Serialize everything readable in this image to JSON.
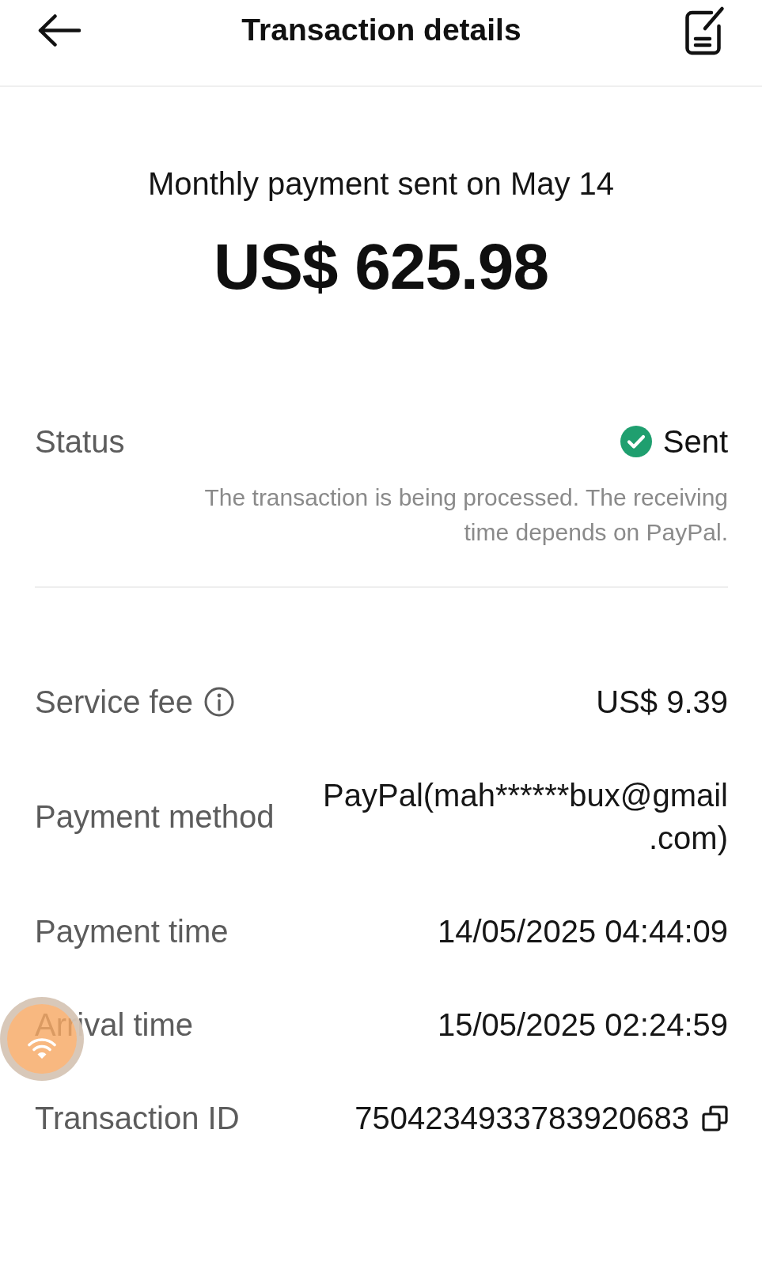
{
  "header": {
    "title": "Transaction details"
  },
  "summary": {
    "caption": "Monthly payment sent on May 14",
    "amount": "US$ 625.98"
  },
  "status": {
    "label": "Status",
    "value": "Sent",
    "note": "The transaction is being processed. The receiving time depends on PayPal."
  },
  "details": [
    {
      "kind": "info",
      "label": "Service fee",
      "value": "US$ 9.39"
    },
    {
      "kind": "plain",
      "label": "Payment method",
      "value": "PayPal(mah******bux@gmail.com)"
    },
    {
      "kind": "plain",
      "label": "Payment time",
      "value": "14/05/2025 04:44:09"
    },
    {
      "kind": "plain",
      "label": "Arrival time",
      "value": "15/05/2025 02:24:59"
    },
    {
      "kind": "copy",
      "label": "Transaction ID",
      "value": "7504234933783920683"
    }
  ]
}
